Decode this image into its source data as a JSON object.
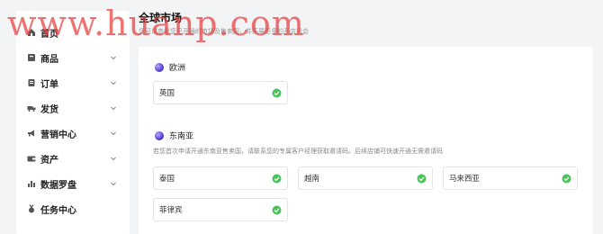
{
  "sidebar": {
    "items": [
      {
        "label": "首页",
        "icon": "home-icon",
        "has_chevron": false
      },
      {
        "label": "商品",
        "icon": "product-icon",
        "has_chevron": true
      },
      {
        "label": "订单",
        "icon": "order-icon",
        "has_chevron": true
      },
      {
        "label": "发货",
        "icon": "shipping-icon",
        "has_chevron": true
      },
      {
        "label": "营销中心",
        "icon": "megaphone-icon",
        "has_chevron": true
      },
      {
        "label": "资产",
        "icon": "wallet-icon",
        "has_chevron": true
      },
      {
        "label": "数据罗盘",
        "icon": "bar-chart-icon",
        "has_chevron": true
      },
      {
        "label": "任务中心",
        "icon": "medal-icon",
        "has_chevron": false
      }
    ]
  },
  "header": {
    "title": "全球市场",
    "subtitle": "您可以查看您已开通的市场及售卖国，并拓展更多的开店机会"
  },
  "regions": [
    {
      "name": "欧洲",
      "note": "",
      "countries": [
        "英国"
      ]
    },
    {
      "name": "东南亚",
      "note": "若您首次申请开通东南亚售卖国，请联系您的专属客户经理获取邀请码。后续店铺可快速开通无需邀请码",
      "countries": [
        "泰国",
        "越南",
        "马来西亚",
        "菲律宾"
      ]
    }
  ],
  "watermark": "www.huanp.com",
  "colors": {
    "check": "#4cc35a",
    "region_icon": "#5b48d6",
    "watermark": "#e63c3c"
  }
}
